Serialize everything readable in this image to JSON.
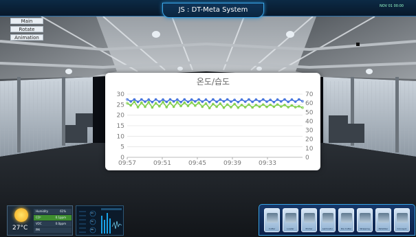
{
  "app": {
    "title": "JS : DT-Meta System",
    "top_mini": "NOV 01 00:00"
  },
  "nav": [
    {
      "label": "Main"
    },
    {
      "label": "Rotate"
    },
    {
      "label": "Animation"
    }
  ],
  "chart_data": {
    "type": "line",
    "title": "온도/습도",
    "categories": [
      "09:57",
      "09:51",
      "09:45",
      "09:39",
      "09:33"
    ],
    "y_left": {
      "ticks": [
        "0",
        "5",
        "10",
        "15",
        "20",
        "25",
        "30"
      ],
      "ylim": [
        0,
        30
      ]
    },
    "y_right": {
      "ticks": [
        "0",
        "10",
        "20",
        "30",
        "40",
        "50",
        "60",
        "70"
      ],
      "ylim": [
        0,
        70
      ]
    },
    "grid": true,
    "legend": "none",
    "series": [
      {
        "color": "#3f6fdc",
        "axis": "left",
        "values": [
          27.5,
          26.5,
          27.5,
          26.3,
          27.5,
          26.4,
          27.4,
          26.2,
          27.5,
          26.4,
          27.4,
          26.3,
          27.5,
          26.5,
          27.4,
          26.2,
          27.5,
          26.3,
          27.4,
          26.5,
          27.5,
          26.4,
          27.4,
          26.2,
          27.5,
          26.3,
          27.4,
          26.5,
          27.5,
          26.4,
          27.3,
          26.2,
          27.4,
          26.4,
          27.5,
          26.3,
          27.4,
          26.5,
          27.5,
          26.4,
          27.3,
          26.2,
          27.4,
          26.5,
          27.5,
          26.3,
          27.4,
          26.4,
          27.5,
          26.6
        ]
      },
      {
        "color": "#7fcf4a",
        "axis": "right",
        "values": [
          60.0,
          57.5,
          61.5,
          55.5,
          60.5,
          56.0,
          61.0,
          55.2,
          60.0,
          56.5,
          61.2,
          55.6,
          60.5,
          56.0,
          61.0,
          56.8,
          60.5,
          57.0,
          60.8,
          57.2,
          60.5,
          56.0,
          59.5,
          54.5,
          59.0,
          56.0,
          59.5,
          55.0,
          58.5,
          55.5,
          59.0,
          55.0,
          58.0,
          55.5,
          58.5,
          55.2,
          58.0,
          56.0,
          58.5,
          55.8,
          58.2,
          56.0,
          58.5,
          56.2,
          58.0,
          55.5,
          57.5,
          55.5,
          56.5,
          55.0
        ]
      }
    ]
  },
  "weather": {
    "temp": "27°C",
    "rows": [
      {
        "label": "Humidity",
        "value": "61%"
      },
      {
        "label": "CO²",
        "value": "0.1ppm"
      },
      {
        "label": "VOC",
        "value": "0.0ppm"
      },
      {
        "label": "PM",
        "value": ""
      }
    ]
  },
  "sensor": {
    "readouts": [
      "93",
      "52",
      "88"
    ]
  },
  "equipment": [
    {
      "label": "Cutter"
    },
    {
      "label": "Loader"
    },
    {
      "label": "Printer"
    },
    {
      "label": "Laminator"
    },
    {
      "label": "Die Cutter"
    },
    {
      "label": "Wrapping"
    },
    {
      "label": "Palletizer"
    },
    {
      "label": "Conveyor"
    }
  ]
}
